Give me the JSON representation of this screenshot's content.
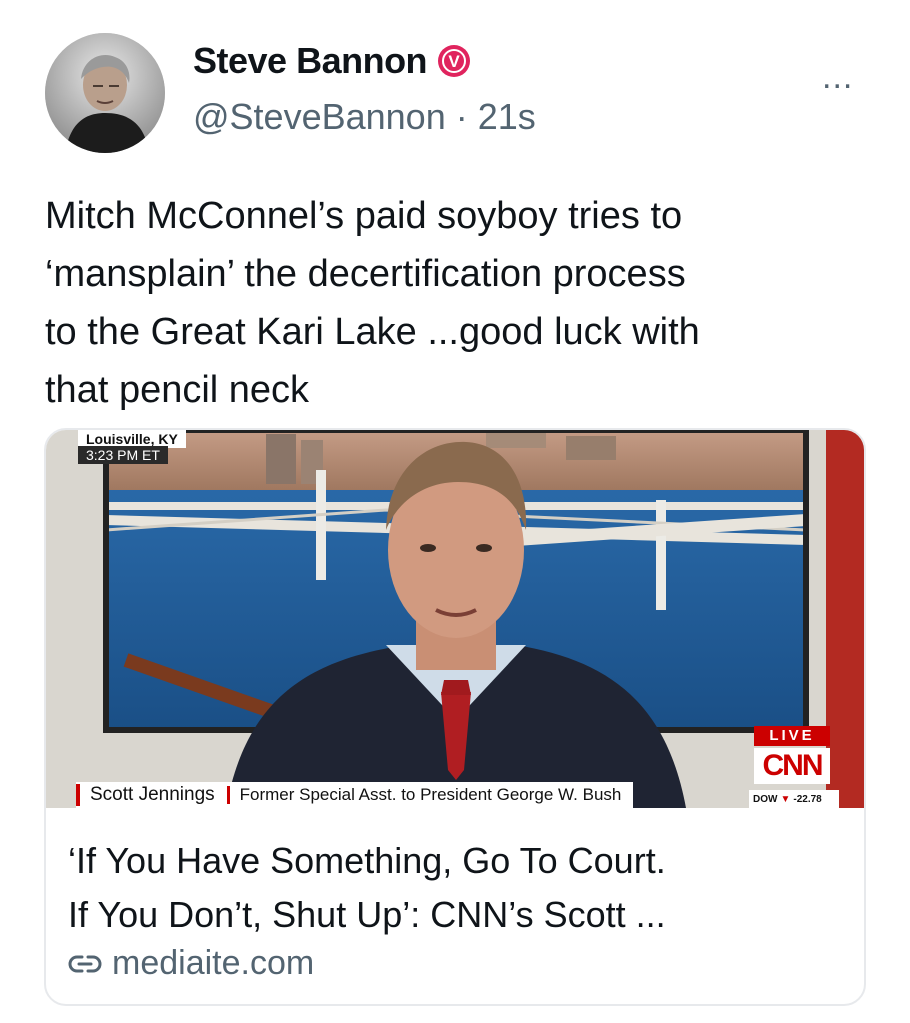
{
  "author": {
    "name": "Steve Bannon",
    "handle": "@SteveBannon",
    "separator": " · ",
    "time": "21s",
    "badge_letter": "V",
    "badge_color": "#e0245e"
  },
  "more_label": "...",
  "tweet": {
    "line1": "Mitch McConnel’s paid soyboy  tries to",
    "line2": "‘mansplain’ the decertification process",
    "line3": "to the Great Kari Lake ...good luck with",
    "line4": "that pencil neck"
  },
  "card": {
    "overlay": {
      "location": "Louisville, KY",
      "time": "3:23 PM ET",
      "chyron_name": "Scott Jennings",
      "chyron_desc": "Former Special Asst. to President George W. Bush",
      "live": "LIVE",
      "network": "CNN",
      "ticker_label": "DOW",
      "ticker_value": "-22.78",
      "ticker_arrow": "▼"
    },
    "title_line1": "‘If You Have Something, Go To Court.",
    "title_line2": "If You Don’t, Shut Up’: CNN’s Scott ...",
    "domain": "mediaite.com"
  },
  "icons": {
    "verified": "verified-badge-icon",
    "more": "more-options-icon",
    "link": "link-icon"
  }
}
